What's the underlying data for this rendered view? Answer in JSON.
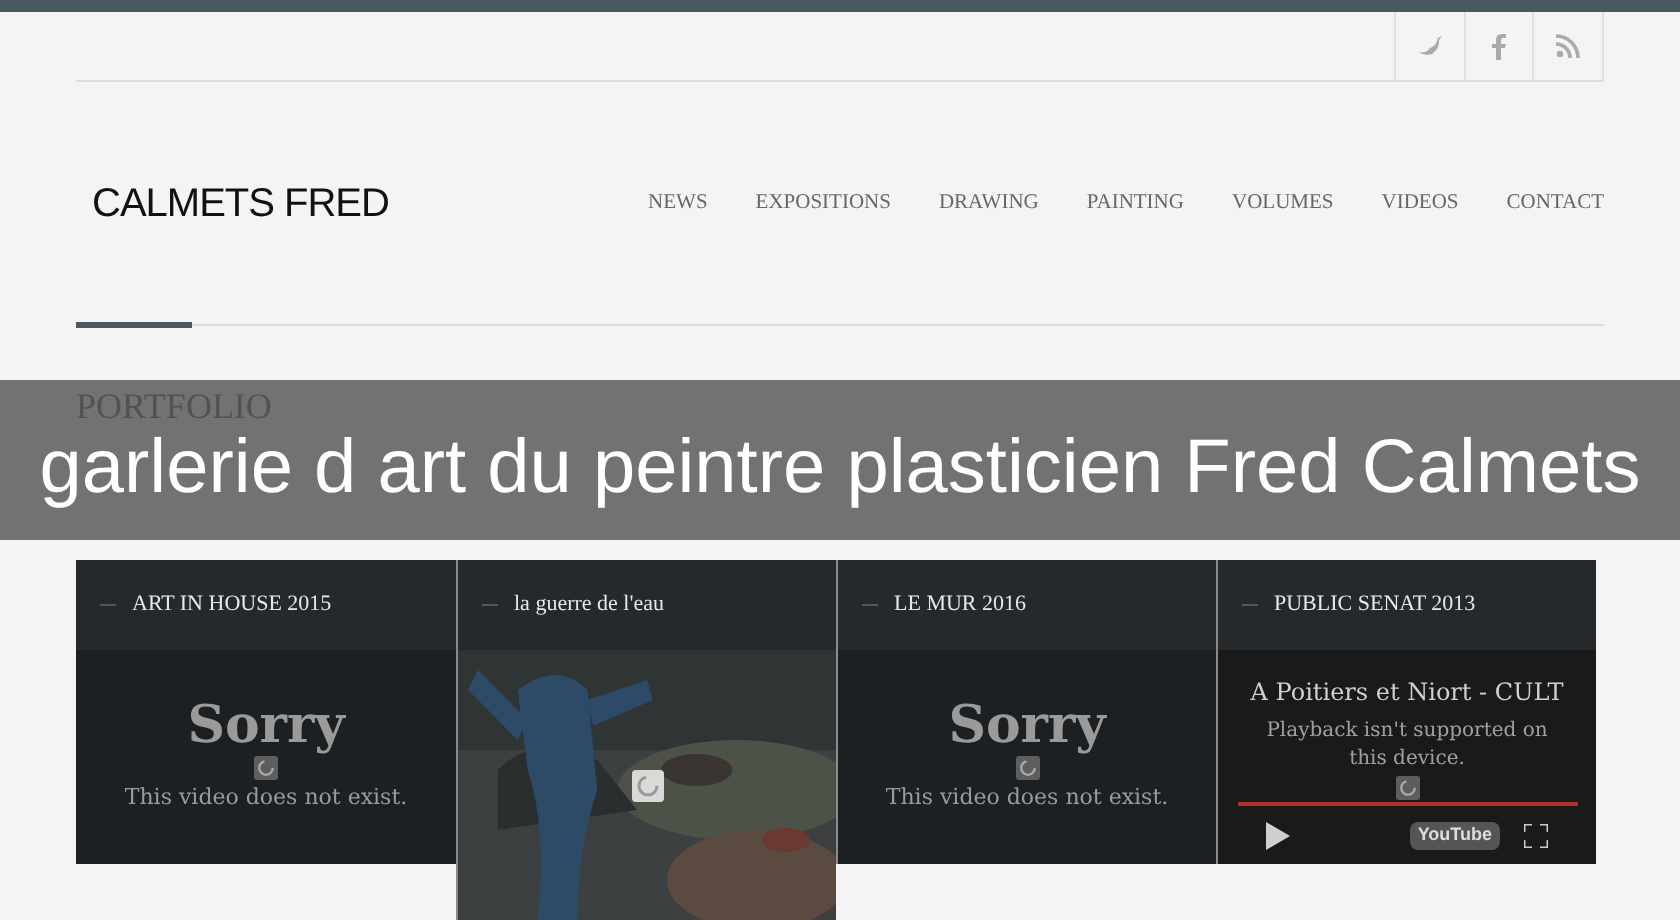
{
  "header": {
    "logo": "CALMETS FRED",
    "nav": [
      "NEWS",
      "EXPOSITIONS",
      "DRAWING",
      "PAINTING",
      "VOLUMES",
      "VIDEOS",
      "CONTACT"
    ]
  },
  "section_title": "PORTFOLIO",
  "banner": "garlerie d art du peintre plasticien Fred Calmets",
  "cards": [
    {
      "title": "ART IN HOUSE 2015",
      "kind": "error",
      "heading": "Sorry",
      "message": "This video does not exist."
    },
    {
      "title": "la guerre de l'eau",
      "kind": "picture"
    },
    {
      "title": "LE MUR 2016",
      "kind": "error",
      "heading": "Sorry",
      "message": "This video does not exist."
    },
    {
      "title": "PUBLIC SENAT 2013",
      "kind": "youtube",
      "heading": "A Poitiers et Niort - CULT",
      "message": "Playback isn't supported on this device.",
      "logo": "YouTube"
    }
  ]
}
